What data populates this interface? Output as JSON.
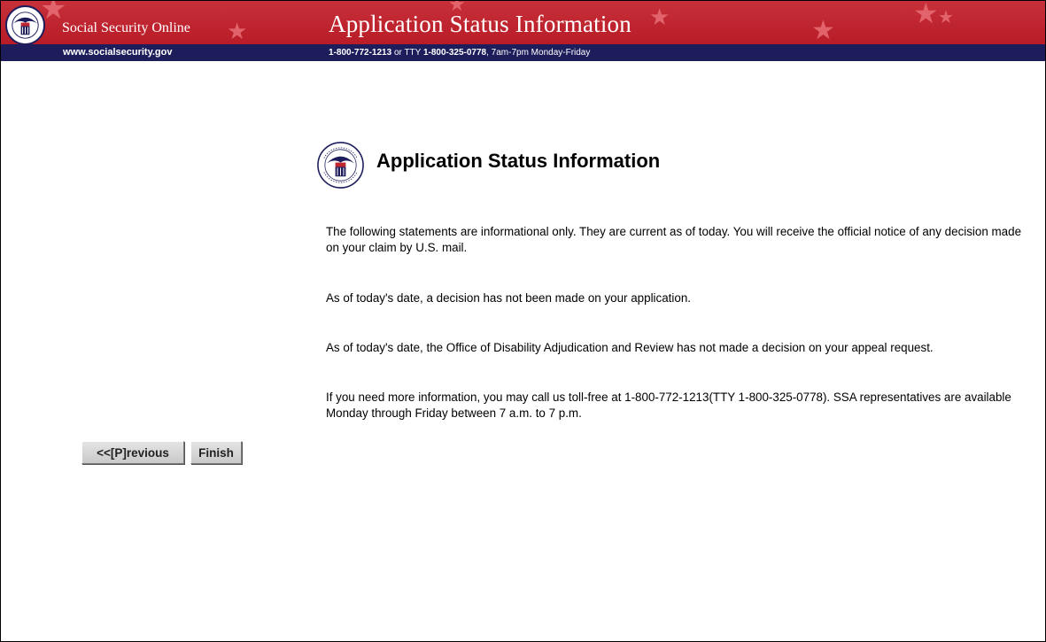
{
  "header": {
    "site_name": "Social Security Online",
    "site_url": "www.socialsecurity.gov",
    "banner_title": "Application Status Information",
    "phone_primary": "1-800-772-1213",
    "phone_or_tty": " or TTY ",
    "phone_tty": "1-800-325-0778",
    "phone_hours": ", 7am-7pm Monday-Friday",
    "colors": {
      "red": "#c0262f",
      "navy": "#1d1d5c"
    }
  },
  "content": {
    "heading": "Application Status Information",
    "seal_icon": "ssa-seal-icon",
    "statements": [
      "The following statements are informational only. They are current as of today. You will receive the official notice of any decision made on your claim by U.S. mail.",
      "As of today's date, a decision has not been made on your application.",
      "As of today's date, the Office of Disability Adjudication and Review has not made a decision on your appeal request.",
      "If you need more information, you may call us toll-free at 1-800-772-1213(TTY 1-800-325-0778). SSA representatives are available Monday through Friday between 7 a.m. to 7 p.m."
    ]
  },
  "buttons": {
    "previous_label": "<<[P]revious",
    "finish_label": "Finish"
  }
}
